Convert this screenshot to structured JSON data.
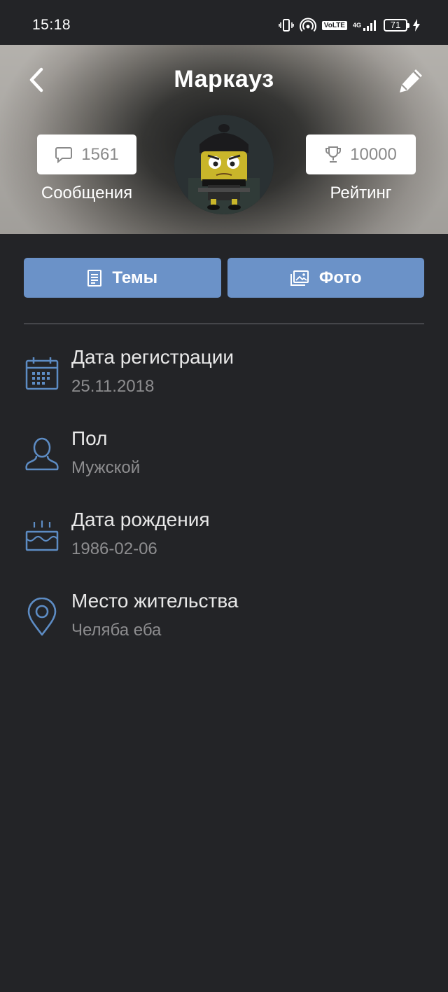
{
  "status_bar": {
    "time": "15:18",
    "signal_label": "4G",
    "volte_label": "VoLTE",
    "battery": "71"
  },
  "header": {
    "title": "Маркауз",
    "back_icon": "chevron-left-icon",
    "edit_icon": "pencil-icon"
  },
  "stats": {
    "messages": {
      "count": "1561",
      "label": "Сообщения",
      "icon": "speech-bubble-icon"
    },
    "rating": {
      "count": "10000",
      "label": "Рейтинг",
      "icon": "trophy-icon"
    }
  },
  "tabs": [
    {
      "label": "Темы",
      "icon": "document-icon"
    },
    {
      "label": "Фото",
      "icon": "photos-icon"
    }
  ],
  "info": [
    {
      "title": "Дата регистрации",
      "value": "25.11.2018",
      "icon": "calendar-icon"
    },
    {
      "title": "Пол",
      "value": "Мужской",
      "icon": "person-icon"
    },
    {
      "title": "Дата рождения",
      "value": "1986-02-06",
      "icon": "birthday-cake-icon"
    },
    {
      "title": "Место жительства",
      "value": "Челяба еба",
      "icon": "location-pin-icon"
    }
  ],
  "colors": {
    "background": "#232427",
    "accent": "#6b92c8",
    "icon_blue": "#5d8cc4",
    "secondary_text": "#8d8d8f"
  }
}
